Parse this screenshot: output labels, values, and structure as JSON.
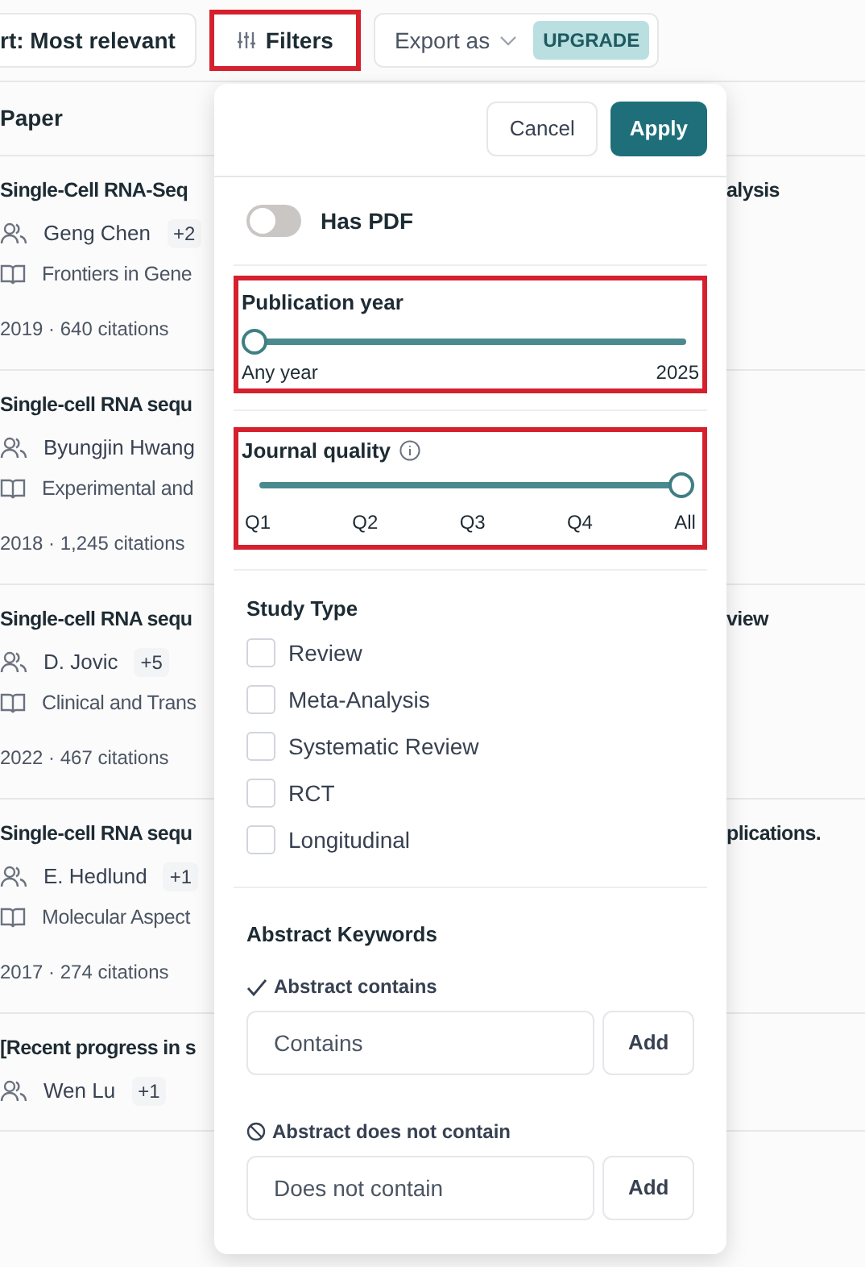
{
  "toolbar": {
    "sort_button": "rt: Most relevant",
    "filters_button": {
      "label": "Filters",
      "highlighted": true
    },
    "export_button": {
      "label": "Export as",
      "badge": "UPGRADE"
    }
  },
  "table": {
    "column_header": "Paper",
    "rows": [
      {
        "title_start": "Single-Cell RNA-Seq",
        "title_end": "alysis",
        "author": "Geng Chen",
        "more_authors": "+2",
        "journal": "Frontiers in Gene",
        "meta": "2019 · 640 citations"
      },
      {
        "title_start": "Single-cell RNA sequ",
        "author": "Byungjin Hwang",
        "journal": "Experimental and",
        "meta": "2018 · 1,245 citations"
      },
      {
        "title_start": "Single-cell RNA sequ",
        "title_end": "view",
        "author": "D. Jovic",
        "more_authors": "+5",
        "journal": "Clinical and Trans",
        "meta": "2022 · 467 citations"
      },
      {
        "title_start": "Single-cell RNA sequ",
        "title_end": "plications.",
        "author": "E. Hedlund",
        "more_authors": "+1",
        "journal": "Molecular Aspect",
        "meta": "2017 · 274 citations"
      },
      {
        "title_start": "[Recent progress in s",
        "author": "Wen Lu",
        "more_authors": "+1"
      }
    ]
  },
  "filter_panel": {
    "cancel_button": "Cancel",
    "apply_button": "Apply",
    "has_pdf": {
      "label": "Has PDF",
      "on": false
    },
    "publication_year": {
      "title": "Publication year",
      "highlighted": true,
      "level": 0,
      "min_label": "Any year",
      "max_label": "2025"
    },
    "journal_quality": {
      "title": "Journal quality",
      "highlighted": true,
      "level": 1,
      "ticks": [
        "Q1",
        "Q2",
        "Q3",
        "Q4",
        "All"
      ]
    },
    "study_type": {
      "title": "Study Type",
      "options": [
        {
          "label": "Review",
          "checked": false
        },
        {
          "label": "Meta-Analysis",
          "checked": false
        },
        {
          "label": "Systematic Review",
          "checked": false
        },
        {
          "label": "RCT",
          "checked": false
        },
        {
          "label": "Longitudinal",
          "checked": false
        }
      ]
    },
    "abstract_keywords": {
      "title": "Abstract Keywords",
      "contains": {
        "label": "Abstract contains",
        "placeholder": "Contains",
        "button": "Add"
      },
      "not_contains": {
        "label": "Abstract does not contain",
        "placeholder": "Does not contain",
        "button": "Add"
      }
    }
  }
}
